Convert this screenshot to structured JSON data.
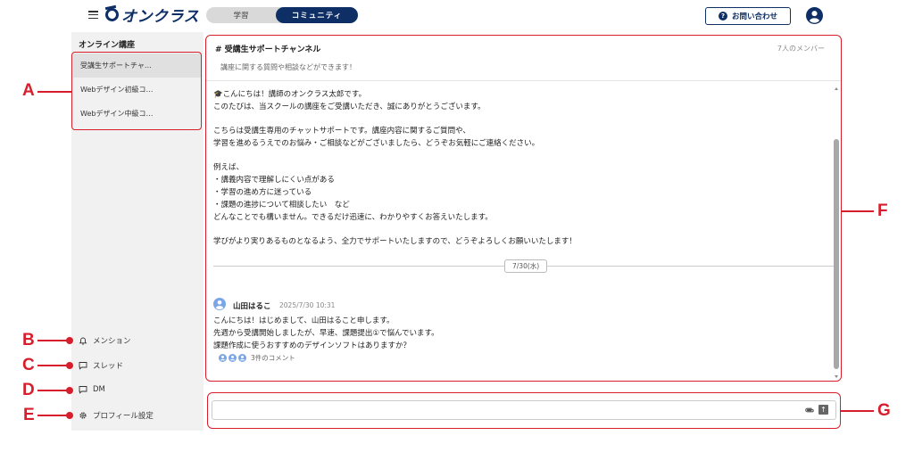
{
  "header": {
    "logo_text": "オンクラス",
    "tabs": [
      {
        "label": "学習"
      },
      {
        "label": "コミュニティ"
      }
    ],
    "contact_label": "お問い合わせ"
  },
  "sidebar": {
    "title": "オンライン講座",
    "channels": [
      {
        "label": "受講生サポートチャ…"
      },
      {
        "label": "Webデザイン初級コ…"
      },
      {
        "label": "Webデザイン中級コ…"
      }
    ],
    "bottom_items": [
      {
        "label": "メンション",
        "icon": "bell-icon"
      },
      {
        "label": "スレッド",
        "icon": "speech-bubble-icon"
      },
      {
        "label": "DM",
        "icon": "speech-bubble-icon"
      },
      {
        "label": "プロフィール設定",
        "icon": "gear-icon"
      }
    ]
  },
  "channel": {
    "name": "# 受講生サポートチャンネル",
    "member_count": "7人のメンバー",
    "description": "講座に関する質問や相談などができます！"
  },
  "messages": {
    "pinned_lines": [
      "🎓こんにちは！講師のオンクラス太郎です。",
      "このたびは、当スクールの講座をご受講いただき、誠にありがとうございます。",
      "こちらは受講生専用のチャットサポートです。講座内容に関するご質問や、",
      "学習を進めるうえでのお悩み・ご相談などがございましたら、どうぞお気軽にご連絡ください。",
      "例えば、",
      "・講義内容で理解しにくい点がある",
      "・学習の進め方に迷っている",
      "・課題の進捗について相談したい　など",
      "どんなことでも構いません。できるだけ迅速に、わかりやすくお答えいたします。",
      "学びがより実りあるものとなるよう、全力でサポートいたしますので、どうぞよろしくお願いいたします！"
    ],
    "date_divider": "7/30(水)",
    "post": {
      "author": "山田はるこ",
      "time": "2025/7/30 10:31",
      "lines": [
        "こんにちは！はじめまして、山田はること申します。",
        "先週から受講開始しましたが、早速、課題提出①で悩んでいます。",
        "課題作成に使うおすすめのデザインソフトはありますか？"
      ],
      "comment_count": "3件のコメント"
    }
  },
  "input": {
    "value": "",
    "placeholder": ""
  },
  "callouts": [
    "A",
    "B",
    "C",
    "D",
    "E",
    "F",
    "G"
  ],
  "colors": {
    "brand": "#0e2f66",
    "callout": "#d81e2c",
    "sidebar_bg": "#f1f1f1"
  }
}
